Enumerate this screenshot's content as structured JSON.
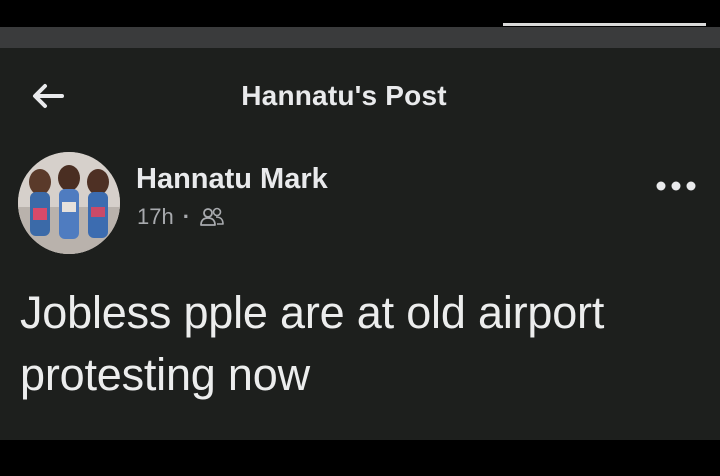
{
  "header": {
    "title": "Hannatu's Post"
  },
  "post": {
    "author": "Hannatu Mark",
    "time": "17h",
    "separator": "·",
    "text": "Jobless pple are at old airport protesting now"
  },
  "icons": {
    "back": "arrow-left-icon",
    "audience": "friends-icon",
    "more": "more-dots-icon"
  },
  "colors": {
    "background": "#1d1f1d",
    "text": "#e9eaec",
    "secondary_text": "#a8aaae"
  }
}
